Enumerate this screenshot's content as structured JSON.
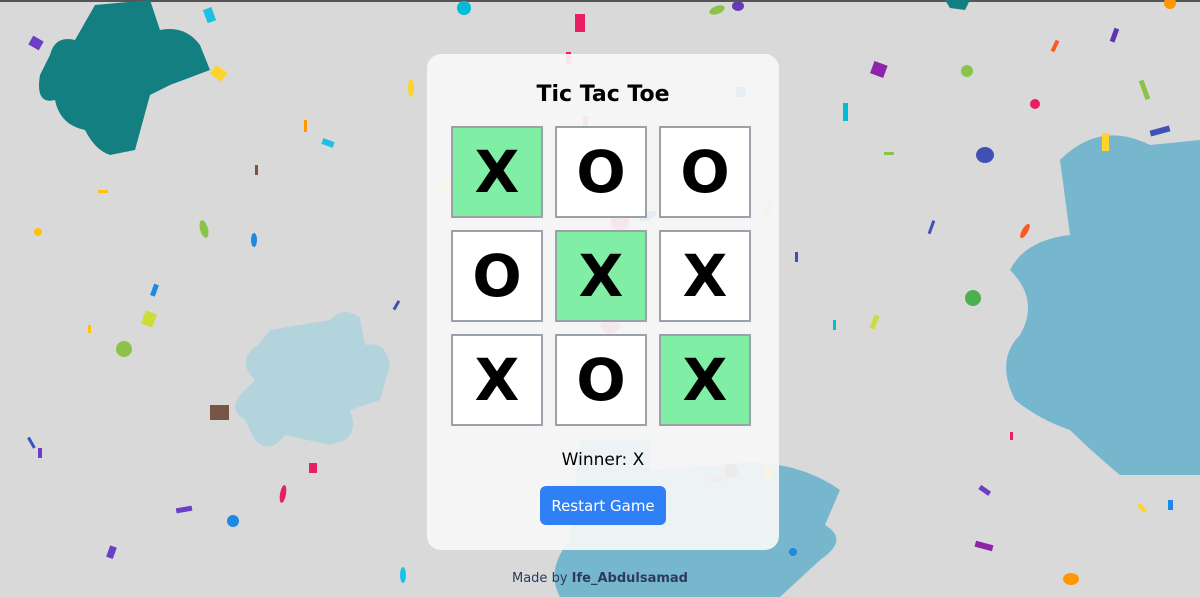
{
  "game": {
    "title": "Tic Tac Toe",
    "board": [
      "X",
      "O",
      "O",
      "O",
      "X",
      "X",
      "X",
      "O",
      "X"
    ],
    "winning_cells": [
      0,
      4,
      8
    ],
    "status": "Winner: X",
    "restart_label": "Restart Game"
  },
  "footer": {
    "prefix": "Made by",
    "author": "Ife_Abdulsamad"
  },
  "colors": {
    "win_cell": "#80eea5",
    "button": "#2f80f5",
    "background": "#d9d9d9"
  }
}
